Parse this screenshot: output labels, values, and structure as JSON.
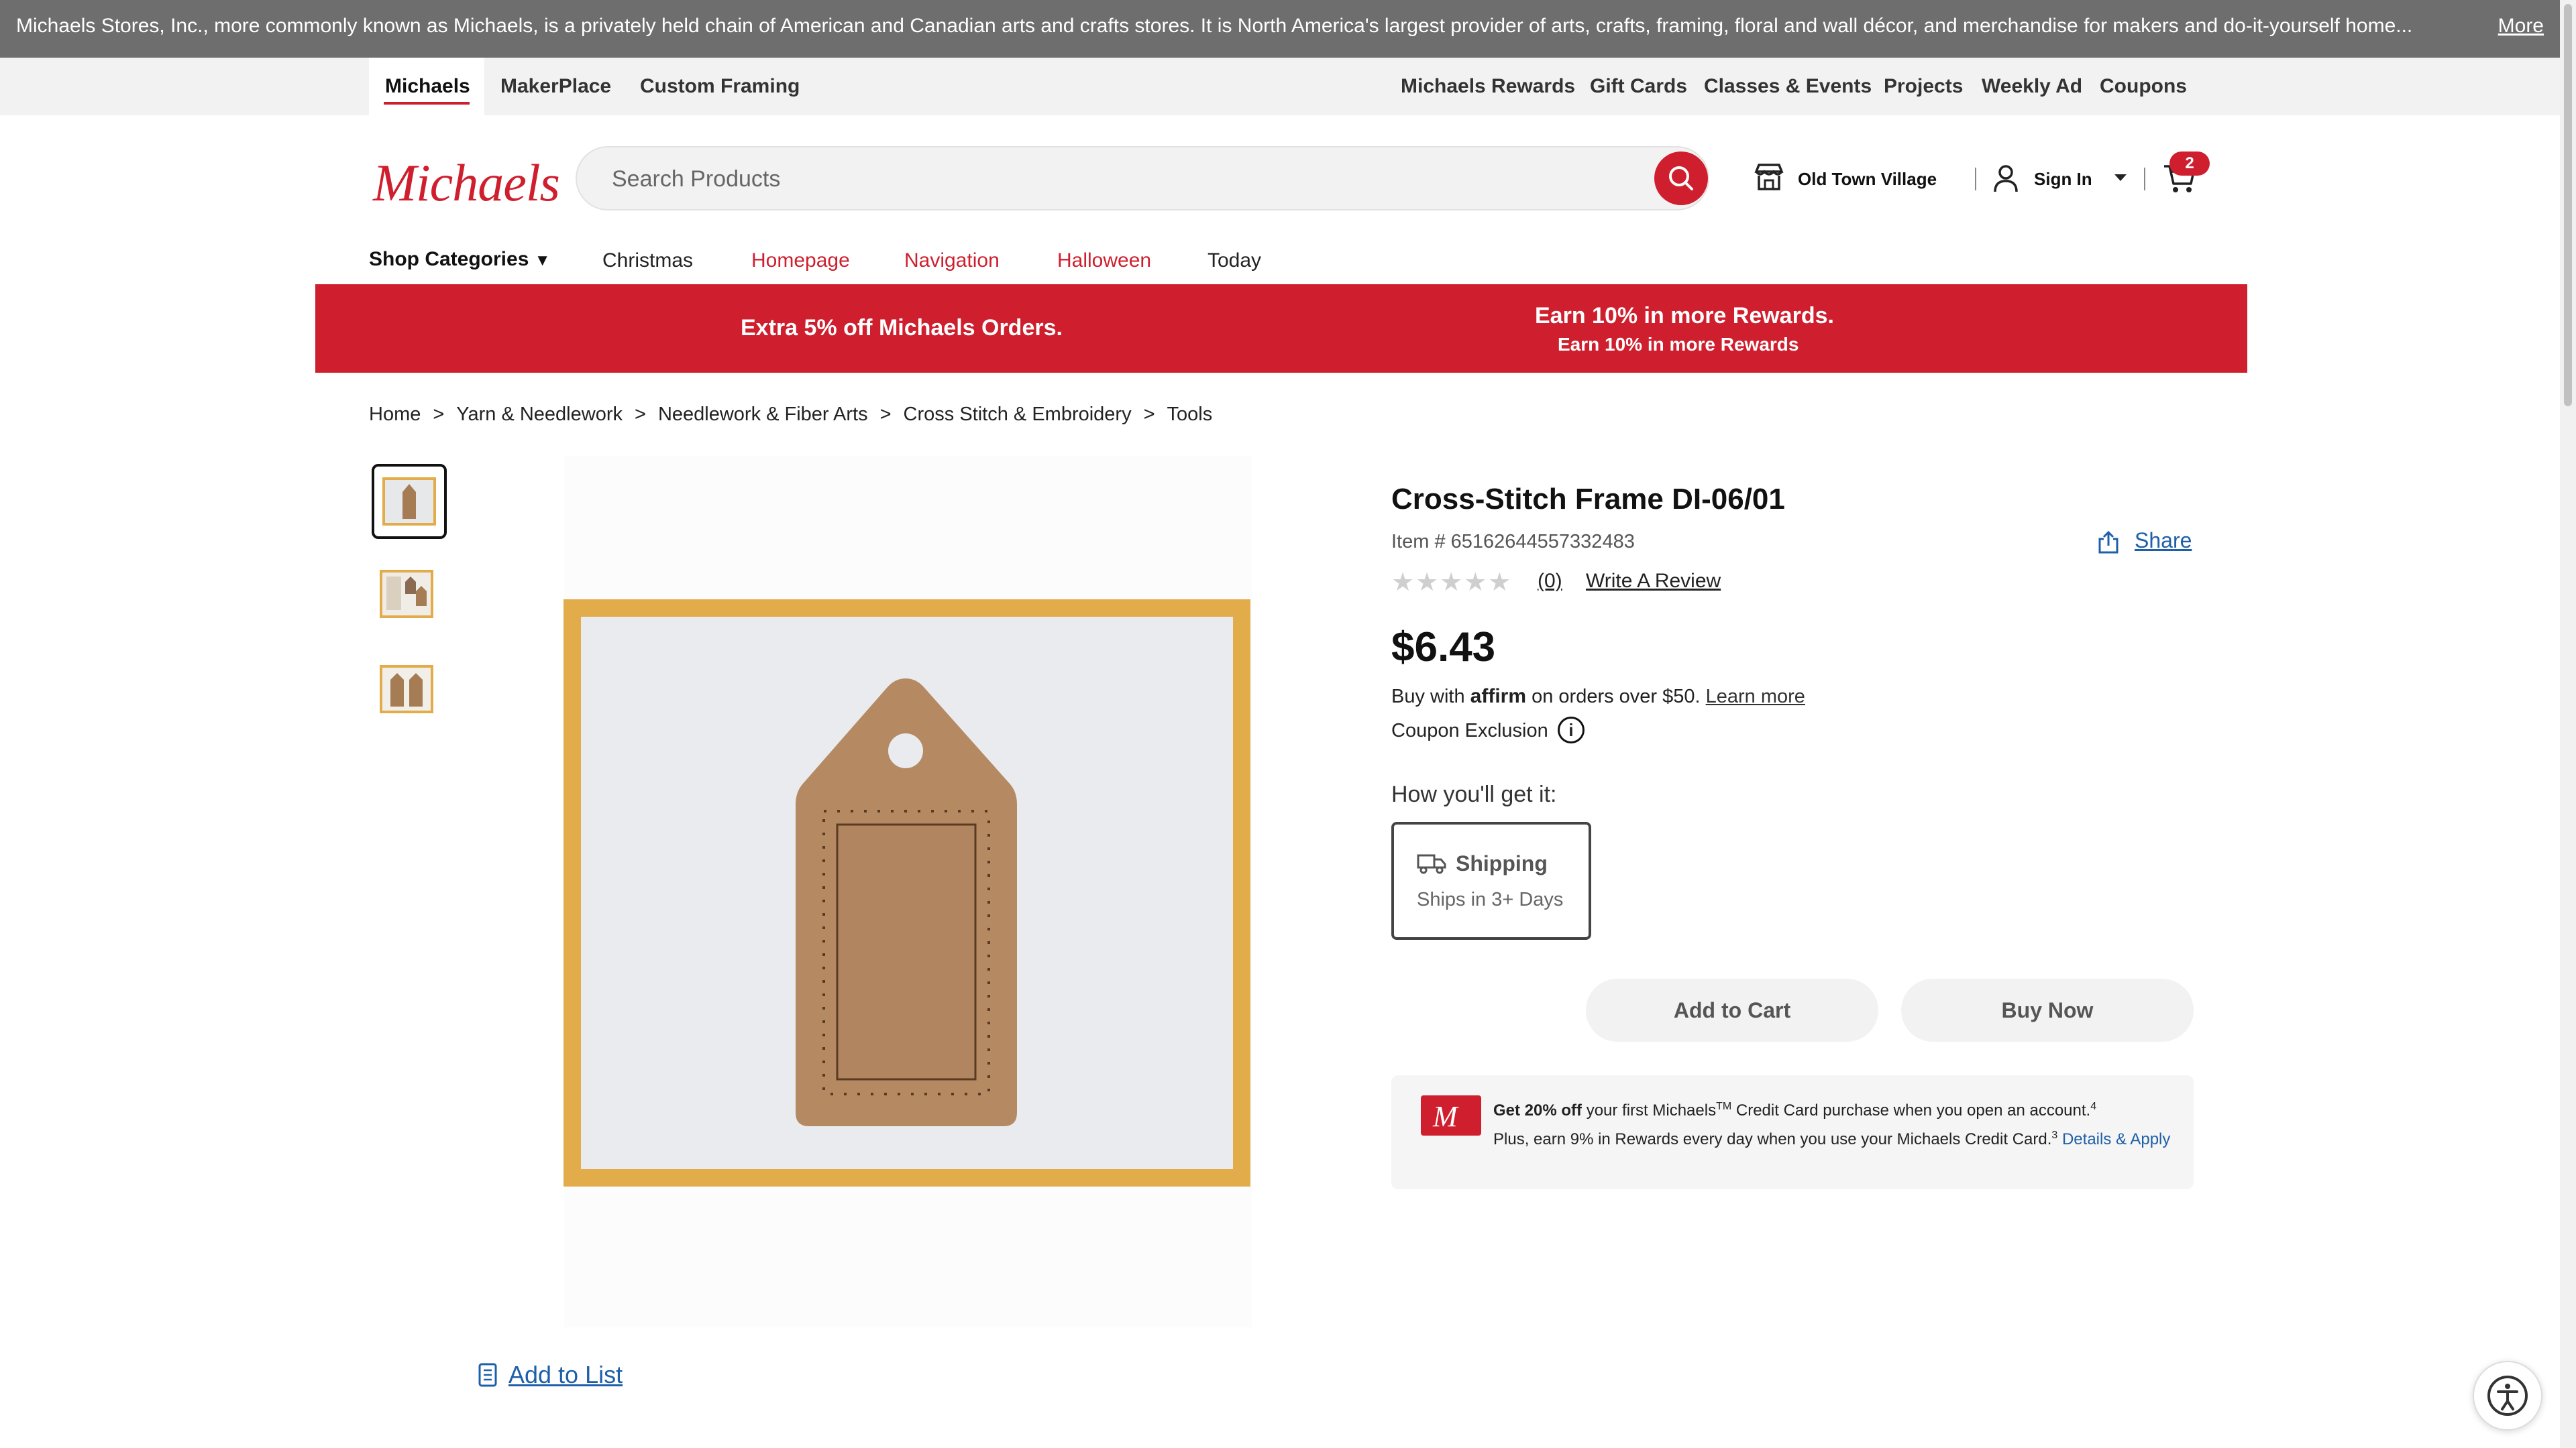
{
  "notice": {
    "text": "Michaels Stores, Inc., more commonly known as Michaels, is a privately held chain of American and Canadian arts and crafts stores. It is North America's largest provider of arts, crafts, framing, floral and wall décor, and merchandise for makers and do-it-yourself home...",
    "more": "More"
  },
  "utility_nav": {
    "left": [
      "Michaels",
      "MakerPlace",
      "Custom Framing"
    ],
    "right": [
      "Michaels Rewards",
      "Gift Cards",
      "Classes & Events",
      "Projects",
      "Weekly Ad",
      "Coupons"
    ]
  },
  "header": {
    "logo": "Michaels",
    "search_placeholder": "Search Products",
    "store": "Old Town Village",
    "sign_in": "Sign In",
    "cart_count": "2"
  },
  "category_nav": {
    "shop_categories": "Shop Categories",
    "items": [
      "Christmas",
      "Homepage",
      "Navigation",
      "Halloween",
      "Today"
    ]
  },
  "banner": {
    "left": "Extra 5% off Michaels Orders.",
    "right_title": "Earn 10% in more Rewards.",
    "right_sub": "Earn 10% in more Rewards"
  },
  "breadcrumb": [
    "Home",
    "Yarn & Needlework",
    "Needlework & Fiber Arts",
    "Cross Stitch & Embroidery",
    "Tools"
  ],
  "breadcrumb_sep": ">",
  "product": {
    "title": "Cross-Stitch Frame DI-06/01",
    "item_no": "Item # 65162644557332483",
    "share": "Share",
    "stars": "★★★★★",
    "rating": 0,
    "review_count": "(0)",
    "write_review": "Write A Review",
    "price": "$6.43",
    "affirm_pre": "Buy with",
    "affirm_brand": "affirm",
    "affirm_post": "on orders over $50.",
    "affirm_learn": "Learn more",
    "coupon_exclusion": "Coupon Exclusion",
    "how_get": "How you'll get it:",
    "shipping_title": "Shipping",
    "shipping_sub": "Ships in 3+ Days",
    "add_to_cart": "Add to Cart",
    "buy_now": "Buy Now"
  },
  "promo": {
    "bold": "Get 20% off",
    "t1": "your first Michaels",
    "tm": "TM",
    "t2": "Credit Card purchase when you open an account.",
    "sup4": "4",
    "t3": "Plus, earn 9% in Rewards every day when you use your Michaels Credit Card.",
    "sup3": "3",
    "details": "Details & Apply"
  },
  "add_to_list": "Add to List",
  "colors": {
    "brand_red": "#cf1f2e",
    "link_blue": "#1d5fa8",
    "frame_gold": "#e2ac4a",
    "wood": "#b58a63"
  },
  "icons": [
    "search-icon",
    "store-icon",
    "user-icon",
    "chevron-down-icon",
    "cart-icon",
    "share-icon",
    "info-icon",
    "truck-icon",
    "list-icon",
    "accessibility-icon"
  ]
}
